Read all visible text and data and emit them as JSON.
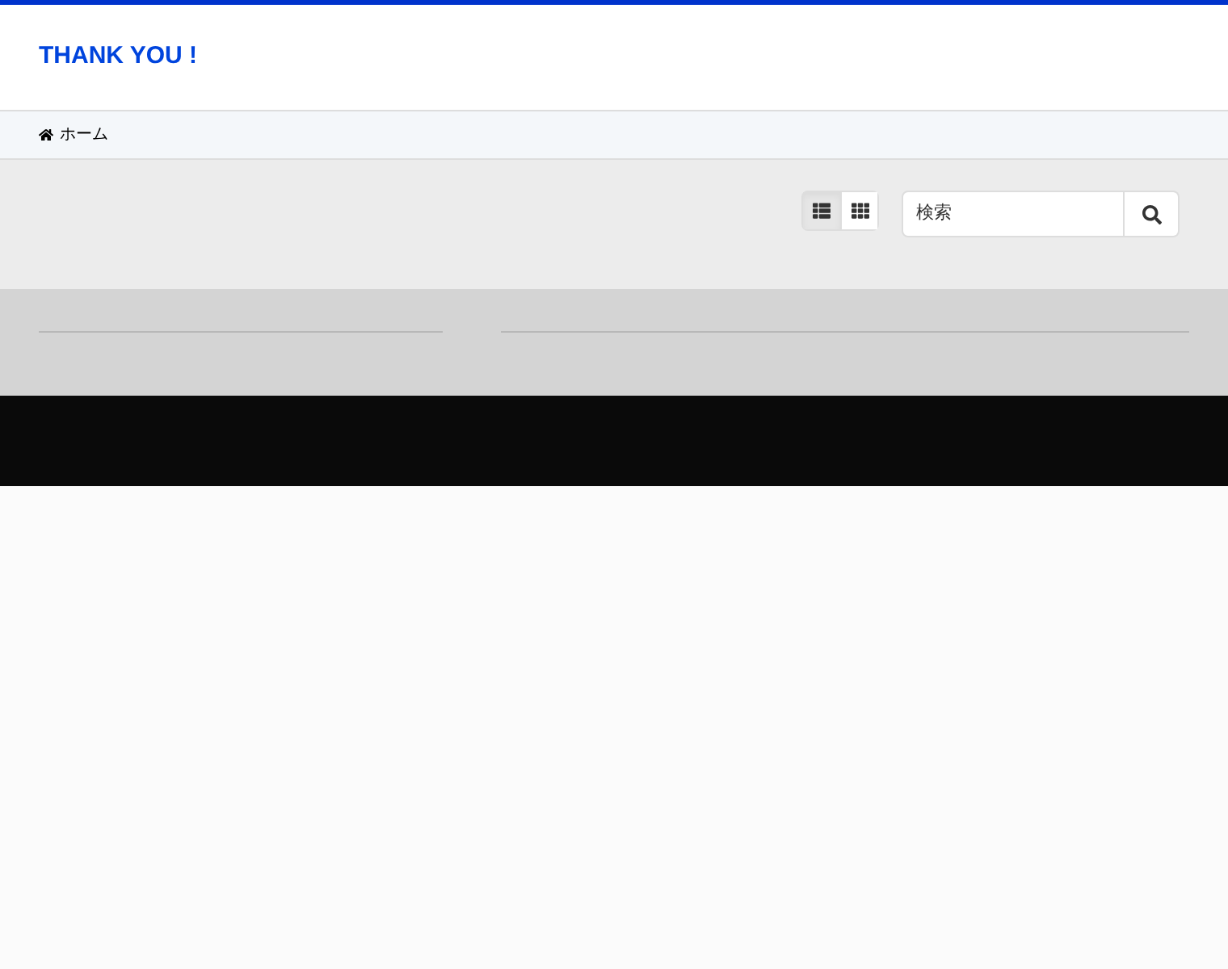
{
  "site_title": "THANK YOU !",
  "breadcrumb": [
    {
      "label": "ホーム"
    }
  ],
  "view_toggle": [
    {
      "kind": "list",
      "selected": true
    },
    {
      "kind": "grid",
      "selected": false
    }
  ],
  "search": {
    "placeholder": "検索"
  }
}
